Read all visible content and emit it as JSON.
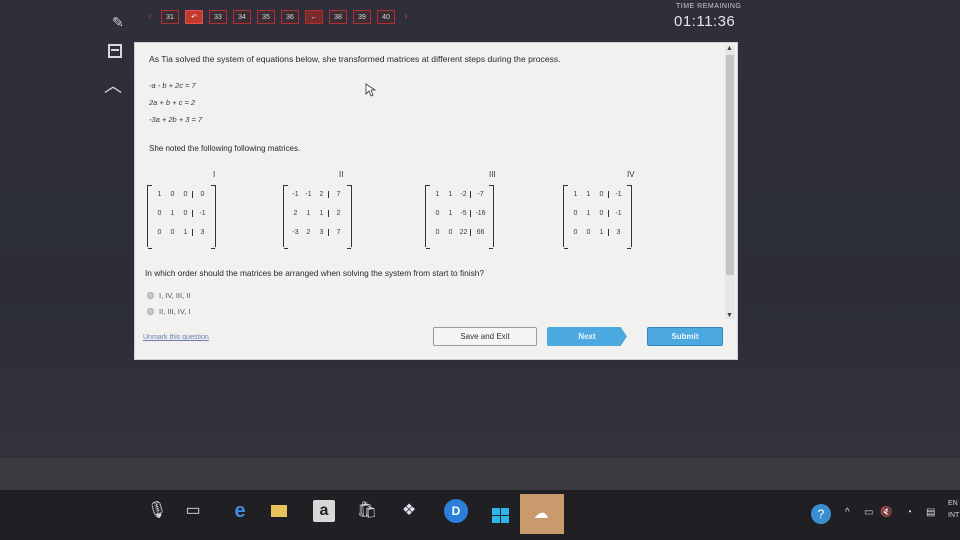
{
  "nav": {
    "prev_arrow": "‹",
    "next_arrow": "›",
    "questions": [
      "31",
      "",
      "33",
      "34",
      "35",
      "36",
      "",
      "38",
      "39",
      "40"
    ],
    "back_icon": "back-arrow-icon"
  },
  "timer": {
    "label": "TIME REMAINING",
    "value": "01:11:36"
  },
  "question": {
    "prompt": "As Tia solved the system of equations below, she transformed matrices at different steps during the process.",
    "equations": [
      "-a - b + 2c = 7",
      "2a + b + c = 2",
      "-3a + 2b + 3 = 7"
    ],
    "noted": "She noted the following following matrices.",
    "matrix_labels": [
      "I",
      "II",
      "III",
      "IV"
    ],
    "matrices": [
      [
        [
          "1",
          "0",
          "0",
          "0"
        ],
        [
          "0",
          "1",
          "0",
          "-1"
        ],
        [
          "0",
          "0",
          "1",
          "3"
        ]
      ],
      [
        [
          "-1",
          "-1",
          "2",
          "7"
        ],
        [
          "2",
          "1",
          "1",
          "2"
        ],
        [
          "-3",
          "2",
          "3",
          "7"
        ]
      ],
      [
        [
          "1",
          "1",
          "-2",
          "-7"
        ],
        [
          "0",
          "1",
          "-5",
          "-16"
        ],
        [
          "0",
          "0",
          "22",
          "66"
        ]
      ],
      [
        [
          "1",
          "1",
          "0",
          "-1"
        ],
        [
          "0",
          "1",
          "0",
          "-1"
        ],
        [
          "0",
          "0",
          "1",
          "3"
        ]
      ]
    ],
    "ask": "In which order should the matrices be arranged when solving the system from start to finish?",
    "options": [
      "I, IV, III, II",
      "II, III, IV, I"
    ]
  },
  "actions": {
    "unmark": "Unmark this question",
    "save_exit": "Save and Exit",
    "next": "Next",
    "submit": "Submit"
  },
  "taskbar": {
    "amazon": "a",
    "dell": "D",
    "help": "?",
    "lang_top": "EN",
    "lang_bottom": "INT"
  },
  "colors": {
    "accent_blue": "#4ca9e0",
    "nav_red": "#c0392b"
  }
}
